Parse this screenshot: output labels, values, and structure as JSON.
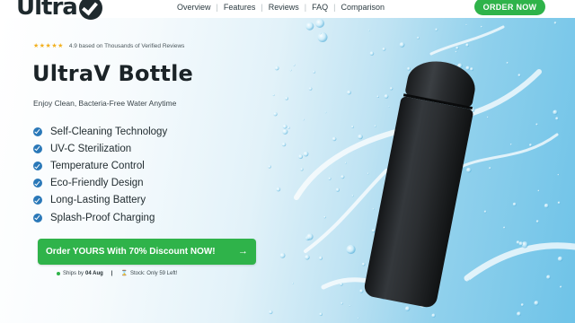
{
  "nav": {
    "logo_text": "Ultra",
    "logo_mark": "V-check-icon",
    "links": [
      "Overview",
      "Features",
      "Reviews",
      "FAQ",
      "Comparison"
    ],
    "separator": "|",
    "order_button": "ORDER NOW"
  },
  "hero": {
    "stars": "★★★★★",
    "rating_text": "4.9 based on Thousands of Verified Reviews",
    "title": "UltraV Bottle",
    "subtitle": "Enjoy Clean, Bacteria-Free Water Anytime",
    "features": [
      "Self-Cleaning Technology",
      "UV-C Sterilization",
      "Temperature Control",
      "Eco-Friendly Design",
      "Long-Lasting Battery",
      "Splash-Proof Charging"
    ],
    "cta_label": "Order YOURS With 70% Discount NOW!",
    "cta_arrow": "→",
    "shipping_prefix": "Ships by",
    "shipping_date": "04 Aug",
    "divider": "|",
    "stock_icon": "⌛",
    "stock_text": "Stock: Only 59 Left!"
  },
  "colors": {
    "brand_green": "#2fb34a",
    "check_blue": "#2a78b8",
    "star_gold": "#f2b01e",
    "text_dark": "#1b2327",
    "water_blue": "#6ec3e8"
  }
}
